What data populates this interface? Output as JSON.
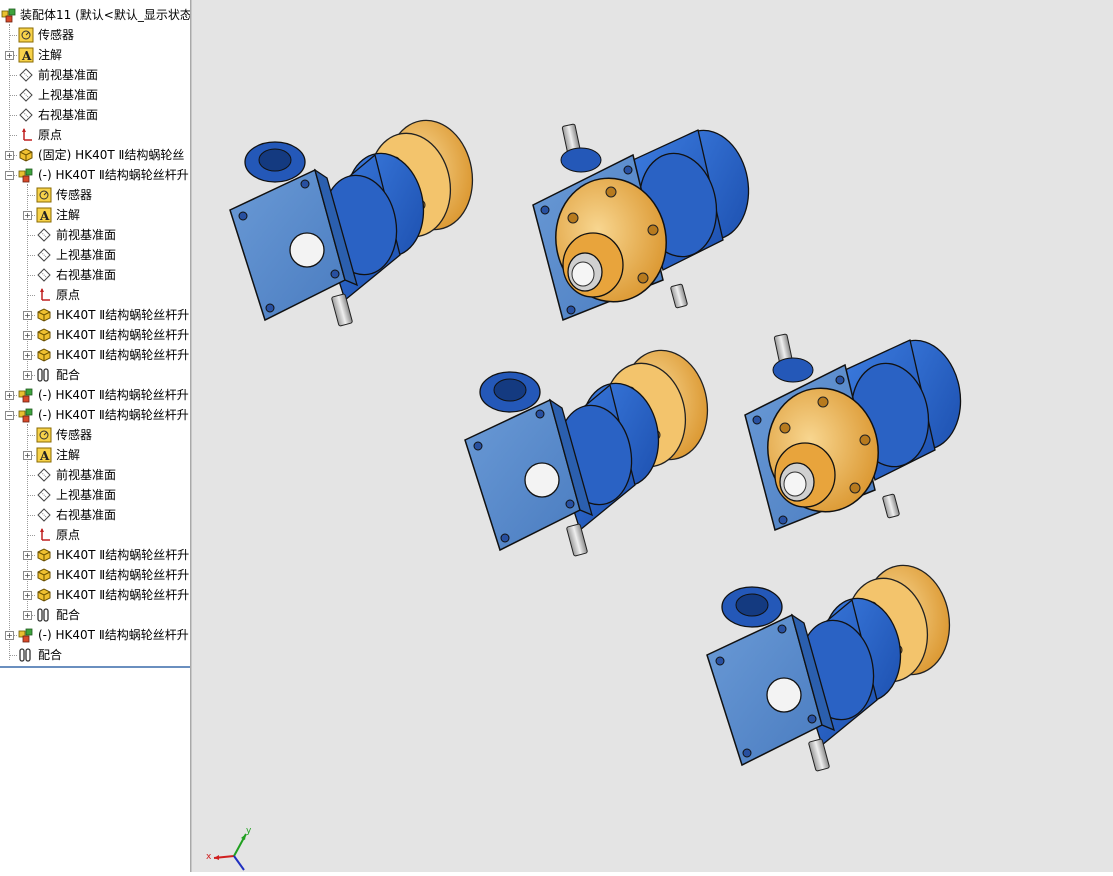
{
  "tree": {
    "root": {
      "label": "装配体11 (默认<默认_显示状态"
    },
    "items": [
      {
        "label": "传感器",
        "icon": "sensor-icon"
      },
      {
        "label": "注解",
        "icon": "annotation-icon"
      },
      {
        "label": "前视基准面",
        "icon": "plane-icon"
      },
      {
        "label": "上视基准面",
        "icon": "plane-icon"
      },
      {
        "label": "右视基准面",
        "icon": "plane-icon"
      },
      {
        "label": "原点",
        "icon": "origin-icon"
      },
      {
        "label": "(固定) HK40T Ⅱ结构蜗轮丝",
        "icon": "part-icon"
      },
      {
        "label": "(-) HK40T Ⅱ结构蜗轮丝杆升",
        "icon": "subassembly-icon"
      },
      {
        "label": "传感器",
        "icon": "sensor-icon"
      },
      {
        "label": "注解",
        "icon": "annotation-icon"
      },
      {
        "label": "前视基准面",
        "icon": "plane-icon"
      },
      {
        "label": "上视基准面",
        "icon": "plane-icon"
      },
      {
        "label": "右视基准面",
        "icon": "plane-icon"
      },
      {
        "label": "原点",
        "icon": "origin-icon"
      },
      {
        "label": "HK40T Ⅱ结构蜗轮丝杆升",
        "icon": "part-icon"
      },
      {
        "label": "HK40T Ⅱ结构蜗轮丝杆升",
        "icon": "part-icon"
      },
      {
        "label": "HK40T Ⅱ结构蜗轮丝杆升",
        "icon": "part-icon"
      },
      {
        "label": "配合",
        "icon": "mates-icon"
      },
      {
        "label": "(-) HK40T Ⅱ结构蜗轮丝杆升",
        "icon": "subassembly-icon"
      },
      {
        "label": "(-) HK40T Ⅱ结构蜗轮丝杆升",
        "icon": "subassembly-icon"
      },
      {
        "label": "传感器",
        "icon": "sensor-icon"
      },
      {
        "label": "注解",
        "icon": "annotation-icon"
      },
      {
        "label": "前视基准面",
        "icon": "plane-icon"
      },
      {
        "label": "上视基准面",
        "icon": "plane-icon"
      },
      {
        "label": "右视基准面",
        "icon": "plane-icon"
      },
      {
        "label": "原点",
        "icon": "origin-icon"
      },
      {
        "label": "HK40T Ⅱ结构蜗轮丝杆升",
        "icon": "part-icon"
      },
      {
        "label": "HK40T Ⅱ结构蜗轮丝杆升",
        "icon": "part-icon"
      },
      {
        "label": "HK40T Ⅱ结构蜗轮丝杆升",
        "icon": "part-icon"
      },
      {
        "label": "配合",
        "icon": "mates-icon"
      },
      {
        "label": "(-) HK40T Ⅱ结构蜗轮丝杆升",
        "icon": "subassembly-icon"
      },
      {
        "label": "配合",
        "icon": "mates-icon"
      }
    ]
  },
  "triad": {
    "x_label": "x",
    "y_label": "y"
  },
  "colors": {
    "housing": "#5b8fd0",
    "housing_dark": "#2a5fb0",
    "motor_blue": "#2260c8",
    "brass": "#e8a43c",
    "brass_light": "#f2c87a",
    "shaft": "#c8c8c8",
    "viewport_bg": "#e4e4e4"
  }
}
